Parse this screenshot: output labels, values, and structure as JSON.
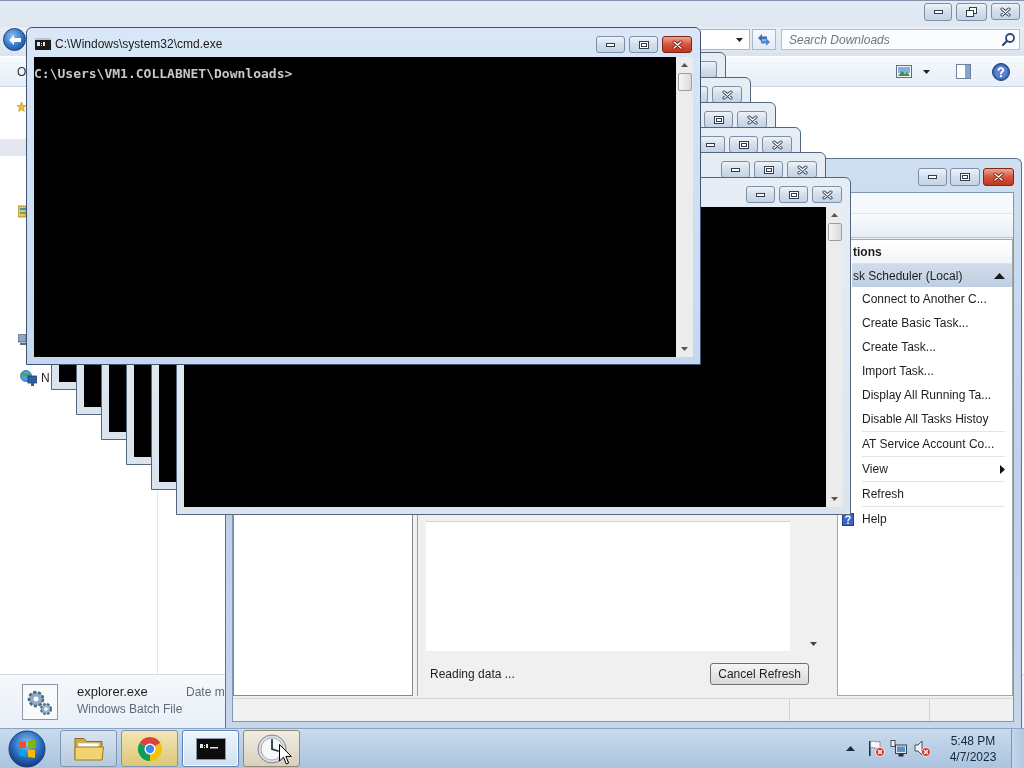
{
  "explorer": {
    "active": false,
    "search": {
      "placeholder": "Search Downloads"
    },
    "toolbar_label": "O",
    "nav_pane": {
      "selected_row": true,
      "network_label": "N"
    },
    "details": {
      "name": "explorer.exe",
      "type": "Windows Batch File",
      "column_3": "Date m"
    }
  },
  "task_scheduler": {
    "active": true,
    "actions_header": "tions",
    "section": {
      "label": "sk Scheduler (Local)",
      "expanded": true
    },
    "actions": [
      {
        "label": "Connect to Another C...",
        "kind": "action",
        "group_start": false
      },
      {
        "label": "Create Basic Task...",
        "kind": "action",
        "group_start": false
      },
      {
        "label": "Create Task...",
        "kind": "action",
        "group_start": false
      },
      {
        "label": "Import Task...",
        "kind": "action",
        "group_start": false
      },
      {
        "label": "Display All Running Ta...",
        "kind": "action",
        "group_start": false
      },
      {
        "label": "Disable All Tasks Histoy",
        "kind": "action",
        "group_start": false
      },
      {
        "label": "AT Service Account Co...",
        "kind": "action",
        "group_start": true
      },
      {
        "label": "View",
        "kind": "submenu",
        "group_start": true
      },
      {
        "label": "Refresh",
        "kind": "action",
        "group_start": true
      },
      {
        "label": "Help",
        "kind": "help",
        "group_start": true
      }
    ],
    "status_text": "Reading data ...",
    "cancel_button": "Cancel Refresh"
  },
  "console": {
    "active": true,
    "title": "C:\\Windows\\system32\\cmd.exe",
    "text": "C:\\Users\\VM1.COLLABNET\\Downloads>"
  },
  "taskbar": {
    "apps": [
      {
        "kind": "explorer",
        "selected": false,
        "hovered": false
      },
      {
        "kind": "browser",
        "selected": false,
        "hovered": false
      },
      {
        "kind": "console",
        "selected": true,
        "hovered": false
      },
      {
        "kind": "scheduler",
        "selected": false,
        "hovered": true
      }
    ],
    "tray": {
      "action_center_alert": true,
      "volume_muted": true
    },
    "clock": {
      "time": "5:48 PM",
      "date": "4/7/2023"
    }
  }
}
